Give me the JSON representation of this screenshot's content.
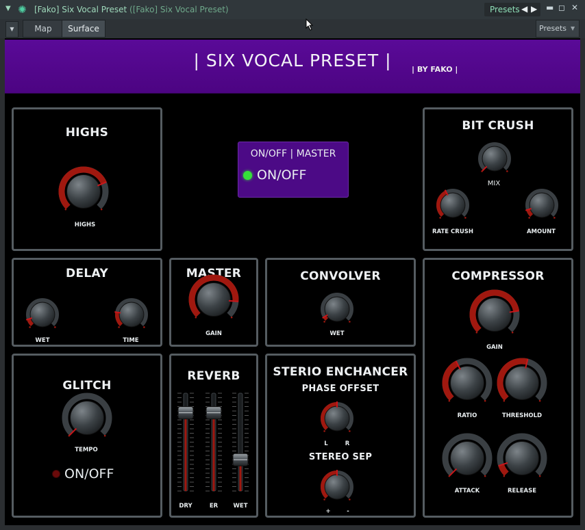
{
  "window": {
    "title": "[Fako] Six Vocal Preset",
    "subtitle": "([Fako] Six Vocal Preset)",
    "presets_label": "Presets"
  },
  "toolbar": {
    "tabs": [
      {
        "label": "Map"
      },
      {
        "label": "Surface"
      }
    ],
    "presets_label": "Presets"
  },
  "header": {
    "title": "| SIX VOCAL PRESET |",
    "byline": "| BY FAKO |"
  },
  "panels": {
    "highs": {
      "title": "HIGHS",
      "knob_label": "HIGHS"
    },
    "onoff_master": {
      "title": "ON/OFF | MASTER",
      "toggle_label": "ON/OFF",
      "led_state": "on"
    },
    "bitcrush": {
      "title": "BIT CRUSH",
      "mix": "MIX",
      "rate": "RATE CRUSH",
      "amount": "AMOUNT"
    },
    "delay": {
      "title": "DELAY",
      "wet": "WET",
      "time": "TIME"
    },
    "master": {
      "title": "MASTER",
      "gain": "GAIN"
    },
    "convolver": {
      "title": "CONVOLVER",
      "wet": "WET"
    },
    "compressor": {
      "title": "COMPRESSOR",
      "gain": "GAIN",
      "ratio": "RATIO",
      "threshold": "THRESHOLD",
      "attack": "ATTACK",
      "release": "RELEASE"
    },
    "glitch": {
      "title": "GLITCH",
      "tempo": "TEMPO",
      "toggle_label": "ON/OFF",
      "led_state": "off"
    },
    "reverb": {
      "title": "REVERB",
      "dry": "DRY",
      "er": "ER",
      "wet": "WET"
    },
    "stereo": {
      "title": "STERIO ENCHANCER",
      "phase": "PHASE OFFSET",
      "l": "L",
      "r": "R",
      "sep": "STEREO SEP",
      "plus": "+",
      "minus": "-"
    }
  },
  "knob_values": {
    "highs": 0.75,
    "bitcrush_mix": 0.0,
    "bitcrush_rate": 0.4,
    "bitcrush_amount": 0.1,
    "delay_wet": 0.1,
    "delay_time": 0.2,
    "master_gain": 0.85,
    "convolver_wet": 0.05,
    "compressor_gain": 0.8,
    "ratio": 0.4,
    "threshold": 0.55,
    "attack": 0.0,
    "release": 0.1,
    "glitch_tempo": 0.0,
    "phase_offset": 0.5,
    "stereo_sep": 0.5
  },
  "fader_values": {
    "dry": 0.8,
    "er": 0.8,
    "wet": 0.32
  },
  "colors": {
    "accent": "#5a0a98",
    "arc": "#a0180f",
    "led_on": "#35e03a",
    "led_off": "#6a0a0a",
    "panel_border": "#555c61"
  }
}
